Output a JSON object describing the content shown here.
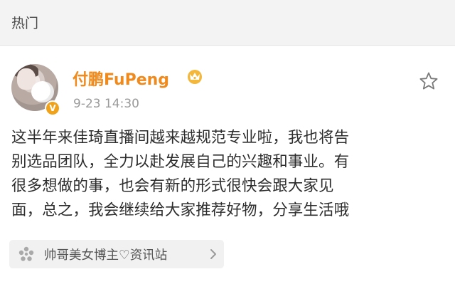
{
  "section": {
    "title": "热门"
  },
  "post": {
    "username": "付鹏FuPeng",
    "timestamp": "9-23 14:30",
    "text_lines": [
      "这半年来佳琦直播间越来越规范专业啦，我也将告",
      "别选品团队，全力以赴发展自己的兴趣和事业。有",
      "很多想做的事，也会有新的形式很快会跟大家见",
      "面，总之，我会继续给大家推荐好物，分享生活哦"
    ],
    "topic_tag": "帅哥美女博主♡资讯站",
    "icons": {
      "verified": "verified-v-icon",
      "vip": "vip-crown-icon",
      "favorite": "star-outline-icon",
      "topic": "super-topic-icon",
      "arrow": "chevron-right-icon"
    }
  },
  "colors": {
    "username": "#f08a1c",
    "verified_badge": "#f0a21a",
    "timestamp": "#9a9a9a",
    "text": "#2d2d2d",
    "tag_background": "#f1f1f1"
  }
}
